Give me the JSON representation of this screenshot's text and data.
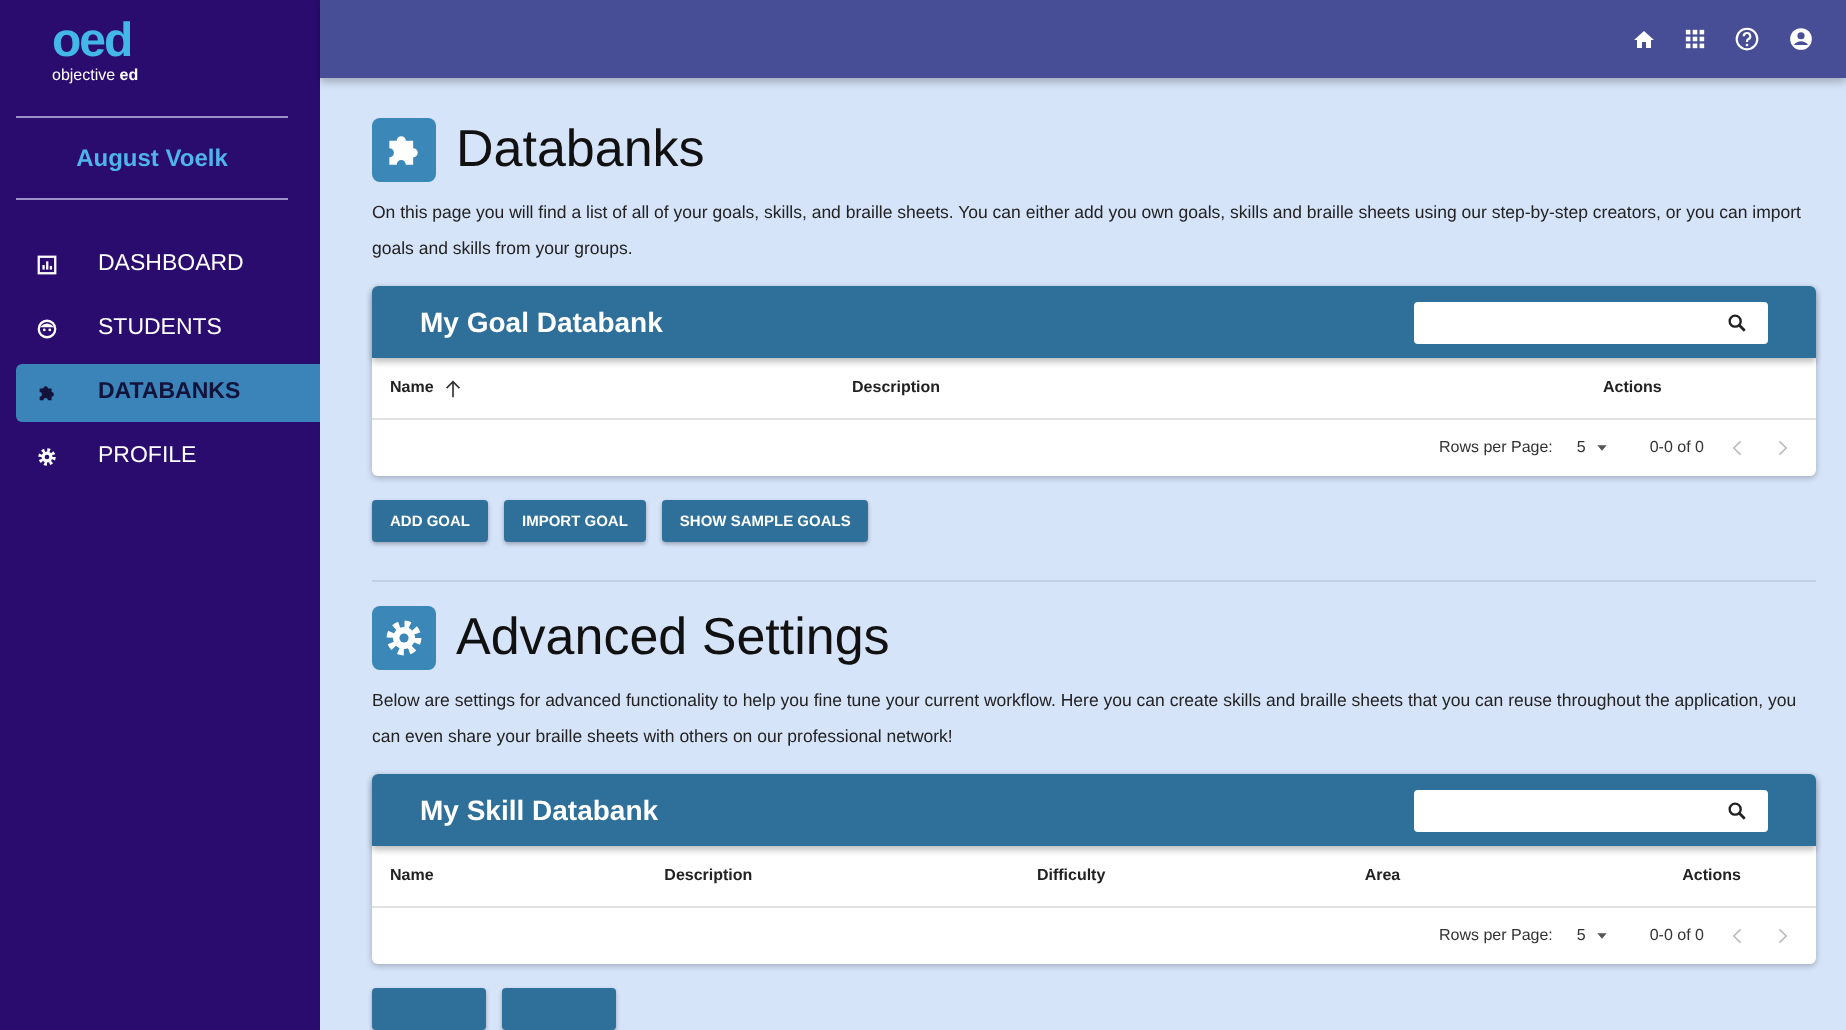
{
  "logo": {
    "mark": "oed",
    "word_light": "objective",
    "word_bold": "ed"
  },
  "user_name": "August Voelk",
  "sidebar": {
    "items": [
      {
        "label": "DASHBOARD",
        "selected": false
      },
      {
        "label": "STUDENTS",
        "selected": false
      },
      {
        "label": "DATABANKS",
        "selected": true
      },
      {
        "label": "PROFILE",
        "selected": false
      }
    ]
  },
  "sections": [
    {
      "title": "Databanks",
      "description": "On this page you will find a list of all of your goals, skills, and braille sheets. You can either add you own goals, skills and braille sheets using our step-by-step creators, or you can import goals and skills from your groups.",
      "table": {
        "title": "My Goal Databank",
        "columns": [
          {
            "label": "Name",
            "sorted": true
          },
          {
            "label": "Description",
            "sorted": false
          },
          {
            "label": "Actions",
            "sorted": false
          }
        ],
        "rows_per_page_label": "Rows per Page:",
        "rows_per_page": "5",
        "range": "0-0 of 0"
      },
      "buttons": [
        {
          "label": "ADD GOAL",
          "kind": "labeled"
        },
        {
          "label": "IMPORT GOAL",
          "kind": "labeled"
        },
        {
          "label": "SHOW SAMPLE GOALS",
          "kind": "labeled"
        }
      ]
    },
    {
      "title": "Advanced Settings",
      "description": "Below are settings for advanced functionality to help you fine tune your current workflow. Here you can create skills and braille sheets that you can reuse throughout the application, you can even share your braille sheets with others on our professional network!",
      "table": {
        "title": "My Skill Databank",
        "columns": [
          {
            "label": "Name",
            "sorted": false
          },
          {
            "label": "Description",
            "sorted": false
          },
          {
            "label": "Difficulty",
            "sorted": false
          },
          {
            "label": "Area",
            "sorted": false
          },
          {
            "label": "Actions",
            "sorted": false
          }
        ],
        "rows_per_page_label": "Rows per Page:",
        "rows_per_page": "5",
        "range": "0-0 of 0"
      },
      "buttons": [
        {
          "kind": "cut"
        },
        {
          "kind": "cut"
        }
      ]
    }
  ]
}
